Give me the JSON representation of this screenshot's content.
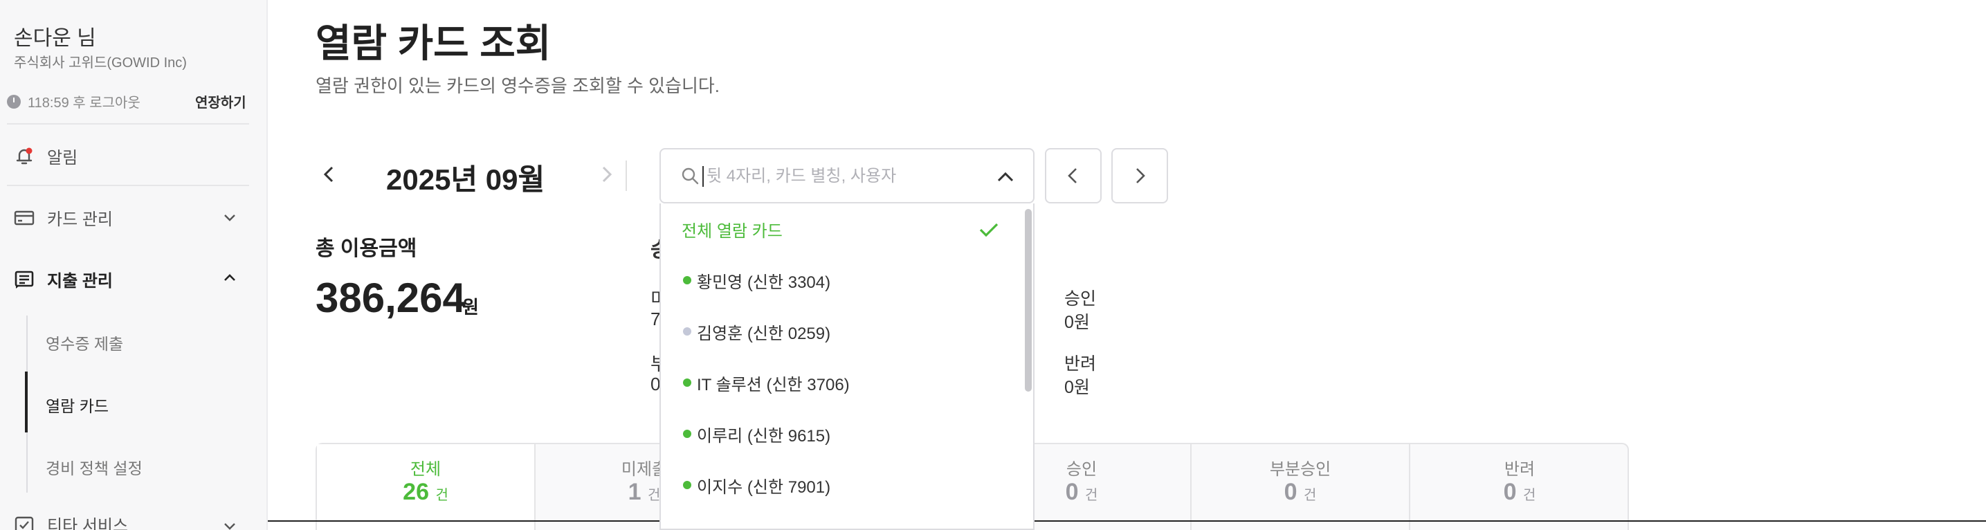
{
  "sidebar": {
    "user_name": "손다운 님",
    "company": "주식회사 고위드(GOWID Inc)",
    "session_text": "118:59 후 로그아웃",
    "extend_label": "연장하기",
    "nav": [
      {
        "label": "알림",
        "icon": "bell-icon"
      },
      {
        "label": "카드 관리",
        "icon": "card-icon"
      },
      {
        "label": "지출 관리",
        "icon": "receipt-icon"
      },
      {
        "label": "티타 서비스",
        "icon": "service-icon"
      }
    ],
    "sub_items": [
      "영수증 제출",
      "열람 카드",
      "경비 정책 설정"
    ]
  },
  "main": {
    "title": "열람 카드 조회",
    "subtitle": "열람 권한이 있는 카드의 영수증을 조회할 수 있습니다.",
    "month": "2025년 09월",
    "search_placeholder": "뒷 4자리, 카드 별칭, 사용자",
    "dropdown": {
      "all_label": "전체 열람 카드",
      "items": [
        {
          "label": "황민영 (신한 3304)",
          "status_color": "#4cbb3a"
        },
        {
          "label": "김영훈 (신한 0259)",
          "status_color": "#c4c8d8"
        },
        {
          "label": "IT 솔루션 (신한 3706)",
          "status_color": "#4cbb3a"
        },
        {
          "label": "이루리 (신한 9615)",
          "status_color": "#4cbb3a"
        },
        {
          "label": "이지수 (신한 7901)",
          "status_color": "#4cbb3a"
        }
      ]
    },
    "total_label": "총 이용금액",
    "total_amount": "386,264",
    "total_unit": "원",
    "peek": {
      "label_initial": "승",
      "row1_a": "미",
      "row1_b": "7",
      "row2_a": "부",
      "row2_b": "0"
    },
    "stats": [
      {
        "label": "승인",
        "value": "0원"
      },
      {
        "label": "반려",
        "value": "0원"
      }
    ],
    "tabs": [
      {
        "label": "전체",
        "count": "26",
        "unit": "건"
      },
      {
        "label": "미제출",
        "count": "1",
        "unit": "건"
      },
      {
        "label": "",
        "count": "",
        "unit": ""
      },
      {
        "label": "승인",
        "count": "0",
        "unit": "건"
      },
      {
        "label": "부분승인",
        "count": "0",
        "unit": "건"
      },
      {
        "label": "반려",
        "count": "0",
        "unit": "건"
      }
    ]
  },
  "colors": {
    "accent": "#4cbb3a",
    "notification": "#e53935"
  }
}
